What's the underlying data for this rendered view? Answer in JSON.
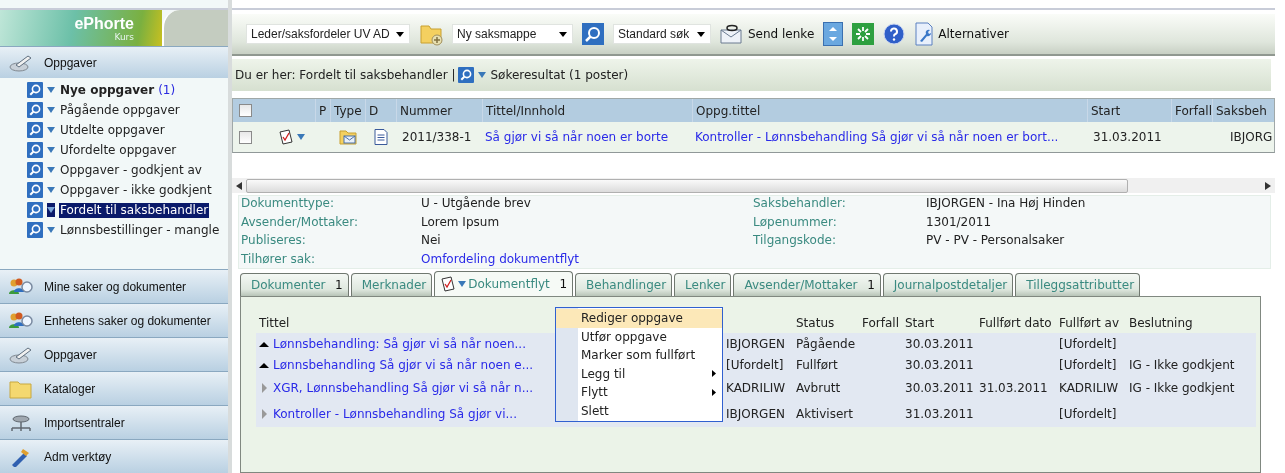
{
  "sidebar": {
    "logo": {
      "name": "ePhorte",
      "subtitle": "Kurs"
    },
    "header": {
      "label": "Oppgaver"
    },
    "tree": [
      {
        "label": "Nye oppgaver",
        "count": "(1)",
        "bold": true,
        "selected": false
      },
      {
        "label": "Pågående oppgaver",
        "bold": false,
        "selected": false
      },
      {
        "label": "Utdelte oppgaver",
        "bold": false,
        "selected": false
      },
      {
        "label": "Ufordelte oppgaver",
        "bold": false,
        "selected": false
      },
      {
        "label": "Oppgaver - godkjent av",
        "bold": false,
        "selected": false
      },
      {
        "label": "Oppgaver - ikke godkjent",
        "bold": false,
        "selected": false
      },
      {
        "label": "Fordelt til saksbehandler",
        "bold": false,
        "selected": true
      },
      {
        "label": "Lønnsbestillinger - mangle",
        "bold": false,
        "selected": false
      }
    ],
    "sections": [
      {
        "label": "Mine saker og dokumenter",
        "kind": "people"
      },
      {
        "label": "Enhetens saker og dokumenter",
        "kind": "people"
      },
      {
        "label": "Oppgaver",
        "kind": "tasks"
      },
      {
        "label": "Kataloger",
        "kind": "folder"
      },
      {
        "label": "Importsentraler",
        "kind": "import"
      },
      {
        "label": "Adm verktøy",
        "kind": "tools"
      }
    ]
  },
  "toolbar": {
    "role_select": "Leder/saksfordeler UV AD",
    "new_select": "Ny saksmappe",
    "search_select": "Standard søk",
    "send_link": "Send lenke",
    "alternatives": "Alternativer"
  },
  "breadcrumb": {
    "path": "Du er her: Fordelt til saksbehandler |",
    "result": "Søkeresultat (1 poster)"
  },
  "results_table": {
    "header_checked": false,
    "columns": [
      "P",
      "Type",
      "D",
      "Nummer",
      "Tittel/Innhold",
      "Oppg.tittel",
      "Start",
      "Forfall",
      "Saksbeh"
    ],
    "rows": [
      {
        "checked": false,
        "number": "2011/338-1",
        "title": "Så gjør vi så når noen er borte",
        "task_title": "Kontroller - Lønnsbehandling Så gjør vi så når noen er bort...",
        "start": "31.03.2011",
        "handler": "IBJORG"
      }
    ]
  },
  "details": {
    "left": [
      {
        "label": "Dokumenttype:",
        "value": "U - Utgående brev",
        "link": false
      },
      {
        "label": "Avsender/Mottaker:",
        "value": "Lorem Ipsum",
        "link": false
      },
      {
        "label": "Publiseres:",
        "value": "Nei",
        "link": false
      },
      {
        "label": "Tilhører sak:",
        "value": "Omfordeling dokumentflyt",
        "link": true
      }
    ],
    "right": [
      {
        "label": "Saksbehandler:",
        "value": "IBJORGEN - Ina Høj Hinden"
      },
      {
        "label": "Løpenummer:",
        "value": "1301/2011"
      },
      {
        "label": "Tilgangskode:",
        "value": "PV - PV - Personalsaker"
      }
    ]
  },
  "tabs": [
    {
      "label": "Dokumenter",
      "count": "1",
      "selected": false
    },
    {
      "label": "Merknader",
      "selected": false
    },
    {
      "label": "Dokumentflyt",
      "count": "1",
      "selected": true
    },
    {
      "label": "Behandlinger",
      "selected": false
    },
    {
      "label": "Lenker",
      "selected": false
    },
    {
      "label": "Avsender/Mottaker",
      "count": "1",
      "selected": false
    },
    {
      "label": "Journalpostdetaljer",
      "selected": false
    },
    {
      "label": "Tilleggsattributter",
      "selected": false
    }
  ],
  "flow_grid": {
    "columns": {
      "title": "Tittel",
      "status": "Status",
      "due": "Forfall",
      "start": "Start",
      "done_date": "Fullført dato",
      "done_by": "Fullført av",
      "decision": "Beslutning"
    },
    "rows": [
      {
        "expanded": true,
        "title": "Lønnsbehandling: Så gjør vi så når noen...",
        "handler": "IBJORGEN",
        "status": "Pågående",
        "start": "30.03.2011",
        "done_by": "[Ufordelt]"
      },
      {
        "expanded": true,
        "title": "Lønnsbehandling Så gjør vi så når noen e...",
        "handler": "[Ufordelt]",
        "status": "Fullført",
        "start": "30.03.2011",
        "done_by": "[Ufordelt]",
        "decision": "IG - Ikke godkjent"
      },
      {
        "expanded": false,
        "title": "XGR, Lønnsbehandling Så gjør vi så når n...",
        "handler": "KADRILIW",
        "status": "Avbrutt",
        "start": "30.03.2011",
        "done_date": "31.03.2011",
        "done_by": "KADRILIW",
        "decision": "IG - Ikke godkjent"
      },
      {
        "expanded": false,
        "title": "Kontroller - Lønnsbehandling Så gjør vi...",
        "handler": "IBJORGEN",
        "status": "Aktivisert",
        "start": "31.03.2011",
        "done_by": "[Ufordelt]"
      }
    ]
  },
  "context_menu": {
    "items": [
      {
        "label": "Rediger oppgave",
        "highlighted": true,
        "submenu": false
      },
      {
        "label": "Utfør oppgave",
        "highlighted": false,
        "submenu": false
      },
      {
        "label": "Marker som fullført",
        "highlighted": false,
        "submenu": false
      },
      {
        "label": "Legg til",
        "highlighted": false,
        "submenu": true
      },
      {
        "label": "Flytt",
        "highlighted": false,
        "submenu": true
      },
      {
        "label": "Slett",
        "highlighted": false,
        "submenu": false
      }
    ]
  }
}
